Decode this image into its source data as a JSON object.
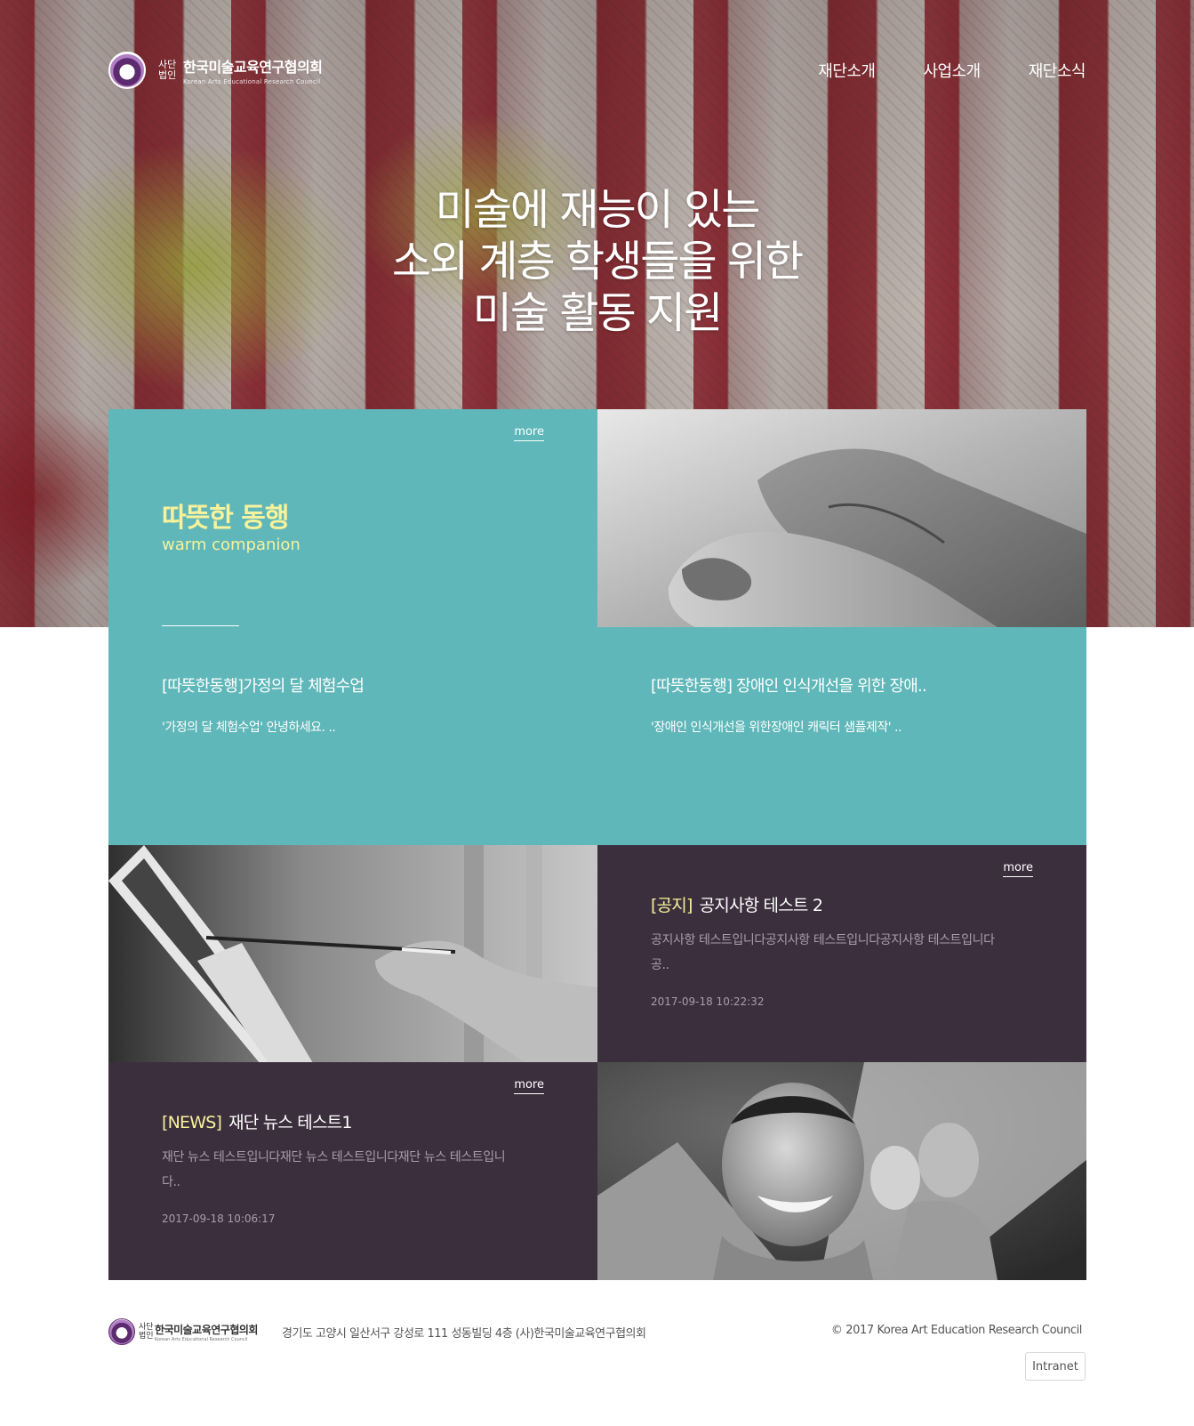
{
  "header": {
    "logo_small": "사단\n법인",
    "logo_name": "한국미술교육연구협의회",
    "logo_en": "Korean Arts Educational Research Council",
    "nav": [
      "재단소개",
      "사업소개",
      "재단소식"
    ]
  },
  "hero": {
    "line1": "미술에 재능이 있는",
    "line2": "소외 계층 학생들을 위한",
    "line3": "미술 활동 지원"
  },
  "companion": {
    "more": "more",
    "title": "따뜻한 동행",
    "subtitle": "warm companion",
    "posts": [
      {
        "title": "[따뜻한동행]가정의 달 체험수업",
        "desc": "'가정의 달 체험수업'    안녕하세요. .."
      },
      {
        "title": "[따뜻한동행] 장애인 인식개선을 위한 장애..",
        "desc": "'장애인 인식개선을 위한장애인 캐릭터 샘플제작' .."
      }
    ]
  },
  "notice": {
    "more": "more",
    "tag": "[공지]",
    "title": "공지사항 테스트 2",
    "body_line1": "공지사항 테스트입니다공지사항 테스트입니다공지사항 테스트입니다",
    "body_line2": "공..",
    "date": "2017-09-18 10:22:32"
  },
  "news": {
    "more": "more",
    "tag": "[NEWS]",
    "title": "재단 뉴스 테스트1",
    "body_line1": "재단 뉴스 테스트입니다재단 뉴스 테스트입니다재단 뉴스 테스트입니",
    "body_line2": "다..",
    "date": "2017-09-18 10:06:17"
  },
  "footer": {
    "logo_small": "사단\n법인",
    "logo_name": "한국미술교육연구협의회",
    "logo_en": "Korean Arts Educational Research Council",
    "address": "경기도 고양시 일산서구 강성로 111 성동빌딩 4층 (사)한국미술교육연구협의회",
    "copyright": "© 2017 Korea Art Education Research Council",
    "intranet": "Intranet"
  },
  "colors": {
    "teal": "#60b7b9",
    "plum": "#3c2f3d",
    "accent_yellow": "#f7f29b"
  }
}
